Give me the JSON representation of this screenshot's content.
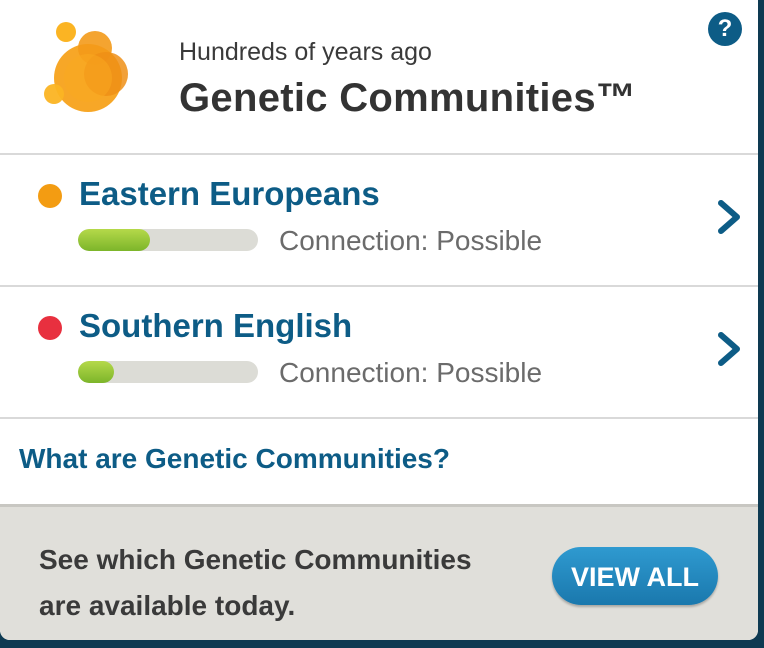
{
  "header": {
    "subtitle": "Hundreds of years ago",
    "title": "Genetic Communities™",
    "help_icon": "question-circle-icon",
    "help_label": "?",
    "logo_icon": "genetic-communities-bubbles-icon"
  },
  "communities": [
    {
      "name": "Eastern Europeans",
      "dot_color": "#f39c12",
      "connection_label": "Connection: Possible",
      "connection_level": 0.4
    },
    {
      "name": "Southern English",
      "dot_color": "#e8303f",
      "connection_label": "Connection: Possible",
      "connection_level": 0.2
    }
  ],
  "info_link": "What are Genetic Communities?",
  "footer": {
    "text": "See which Genetic Communities are available today.",
    "button_label": "VIEW ALL"
  },
  "colors": {
    "brand_blue": "#0d5c86",
    "progress_green": "#8cc63f",
    "button_blue": "#2389c0"
  }
}
